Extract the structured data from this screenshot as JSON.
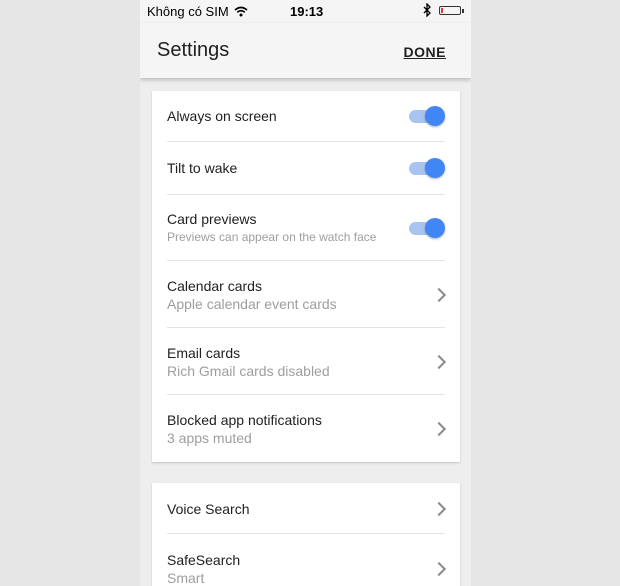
{
  "status_bar": {
    "carrier": "Không có SIM",
    "time": "19:13"
  },
  "header": {
    "title": "Settings",
    "done_label": "DONE"
  },
  "toggles": [
    {
      "label": "Always on screen",
      "on": true
    },
    {
      "label": "Tilt to wake",
      "on": true
    },
    {
      "label": "Card previews",
      "sublabel": "Previews can appear on the watch face",
      "on": true
    }
  ],
  "nav_items": [
    {
      "label": "Calendar cards",
      "sublabel": "Apple calendar event cards"
    },
    {
      "label": "Email cards",
      "sublabel": "Rich Gmail cards disabled"
    },
    {
      "label": "Blocked app notifications",
      "sublabel": "3 apps muted"
    }
  ],
  "search_items": [
    {
      "label": "Voice Search"
    },
    {
      "label": "SafeSearch",
      "sublabel": "Smart"
    }
  ],
  "colors": {
    "accent": "#4285f4",
    "track_on": "#a9c4f0",
    "background": "#eeeeee"
  },
  "icons": [
    "wifi-icon",
    "bluetooth-icon",
    "battery-icon",
    "chevron-right-icon"
  ]
}
